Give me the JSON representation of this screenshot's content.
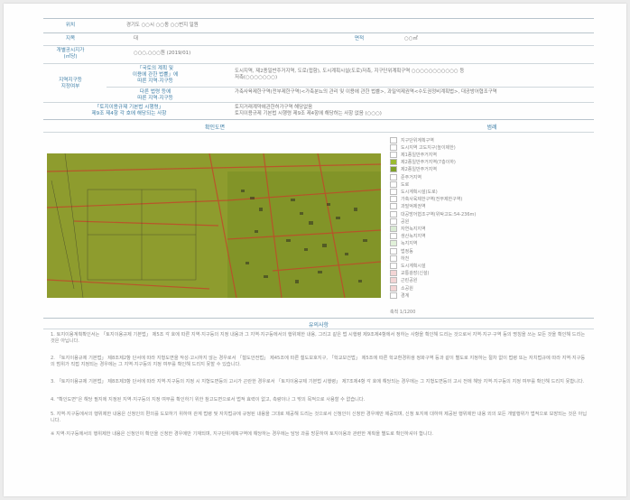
{
  "document": {
    "header": {
      "label": "위치",
      "value": "경기도 ○○시 ○○동 ○○번지 일원"
    },
    "rows": [
      {
        "label": "지목",
        "value": "대",
        "label2": "면적",
        "value2": "○○㎡"
      },
      {
        "label": "개별공시지가\n(㎡당)",
        "value": "○○○,○○○원 (2019/01)"
      },
      {
        "label": "지역지구등\n지정여부",
        "sublabels": [
          "「국토의 계획 및\n이용에 관한 법률」에\n따른 지역·지구등",
          "다른 법령 등에\n따른 지역·지구등"
        ],
        "values": [
          "도시지역, 제2종일반주거지역, 도로(접함), 도시계획시설(도로)저촉, 지구단위계획구역 ○○○○○○○○○○○ 등\n저촉(○○○○○○○)",
          "가축사육제한구역(전부제한구역)<가축분뇨의 관리 및 이용에 관한 법률>, 과밀억제권역<수도권정비계획법>, 대공방어협조구역"
        ]
      },
      {
        "label": "「토지이용규제 기본법 시행령」\n제9조 제4항 각 호에 해당되는 사항",
        "value": "토지거래계약에관한허가구역 해당없음\n토지이용규제 기본법 시행령 제9조 제4항에 해당하는 사항 없음 (○○○)"
      }
    ],
    "map_title": "확인도면",
    "legend_title": "범례",
    "legend": [
      {
        "text": "지구단위계획구역",
        "color": "#ffffff"
      },
      {
        "text": "도시지역 고도지구(높이제한)",
        "color": "#ffffff"
      },
      {
        "text": "제1종일반주거지역",
        "color": "#ffffff"
      },
      {
        "text": "제2종일반주거지역(7층이하)",
        "color": "#9bbb33"
      },
      {
        "text": "제2종일반주거지역",
        "color": "#7fa12a"
      },
      {
        "text": "준주거지역",
        "color": "#ffffff"
      },
      {
        "text": "도로",
        "color": "#ffffff"
      },
      {
        "text": "도시계획시설(도로)",
        "color": "#ffffff"
      },
      {
        "text": "가축사육제한구역(전부제한구역)",
        "color": "#ffffff"
      },
      {
        "text": "과밀억제권역",
        "color": "#ffffff"
      },
      {
        "text": "대공방어협조구역(위탁고도:54-236m)",
        "color": "#ffffff"
      },
      {
        "text": "공원",
        "color": "#ffffff"
      },
      {
        "text": "자연녹지지역",
        "color": "#d9ead3"
      },
      {
        "text": "생산녹지지역",
        "color": "#ffffff"
      },
      {
        "text": "녹지지역",
        "color": "#e0f0d8"
      },
      {
        "text": "법정동",
        "color": "#ffffff"
      },
      {
        "text": "하천",
        "color": "#ffffff"
      },
      {
        "text": "도시계획시설",
        "color": "#ffffff"
      },
      {
        "text": "교통광장(신설)",
        "color": "#f3d5d5"
      },
      {
        "text": "근린공원",
        "color": "#f3d5d5"
      },
      {
        "text": "소공원",
        "color": "#f3d5d5"
      },
      {
        "text": "경계",
        "color": "#ffffff"
      }
    ],
    "scale": "축척 1/1200",
    "notice_title": "유의사항",
    "notices": [
      "1. 토지이용계획확인서는 「토지이용규제 기본법」 제5조 각 호에 따른 지역·지구등의 지정 내용과 그 지역·지구등에서의 행위제한 내용, 그리고 같은 법 시행령 제9조제4항에서 정하는 사항을 확인해 드리는 것으로서 지역·지구·구역 등의 명칭을 쓰는 모든 것을 확인해 드리는 것은 아닙니다.",
      "2. 「토지이용규제 기본법」 제8조제2항 단서에 따라 지형도면을 작성·고시하지 않는 경우로서 「철도안전법」 제45조에 따른 철도보호지구, 「학교보건법」 제5조에 따른 학교환경위생 정화구역 등과 같이 별도로 지정하는 절차 없이 법령 또는 자치법규에 따라 지역·지구등의 범위가 직접 지정되는 경우에는 그 지역·지구등의 지정 여부를 확인해 드리지 못할 수 있습니다.",
      "3. 「토지이용규제 기본법」 제8조제3항 단서에 따라 지역·지구등의 지정 시 지형도면등의 고시가 곤란한 경우로서 「토지이용규제 기본법 시행령」 제7조제4항 각 호에 해당되는 경우에는 그 지형도면등의 고시 전에 해당 지역·지구등의 지정 여부를 확인해 드리지 못합니다.",
      "4. \"확인도면\"은 해당 필지에 지정된 지역·지구등의 지정 여부를 확인하기 위한 참고도면으로서 법적 효력이 없고, 측량이나 그 밖의 목적으로 사용할 수 없습니다.",
      "5. 지역·지구등에서의 행위제한 내용은 신청인의 편의를 도모하기 위하여 관계 법령 및 자치법규에 규정된 내용을 그대로 제공해 드리는 것으로서 신청인이 신청한 경우에만 제공되며, 신청 토지에 대하여 제공된 행위제한 내용 외의 모든 개발행위가 법적으로 보장되는 것은 아닙니다.",
      "※ 지역·지구등에서의 행위제한 내용은 신청인이 확인을 신청한 경우에만 기재되며, 지구단위계획구역에 해당하는 경우에는 담당 과를 방문하여 토지이용과 관련한 계획을 별도로 확인하셔야 합니다."
    ]
  }
}
